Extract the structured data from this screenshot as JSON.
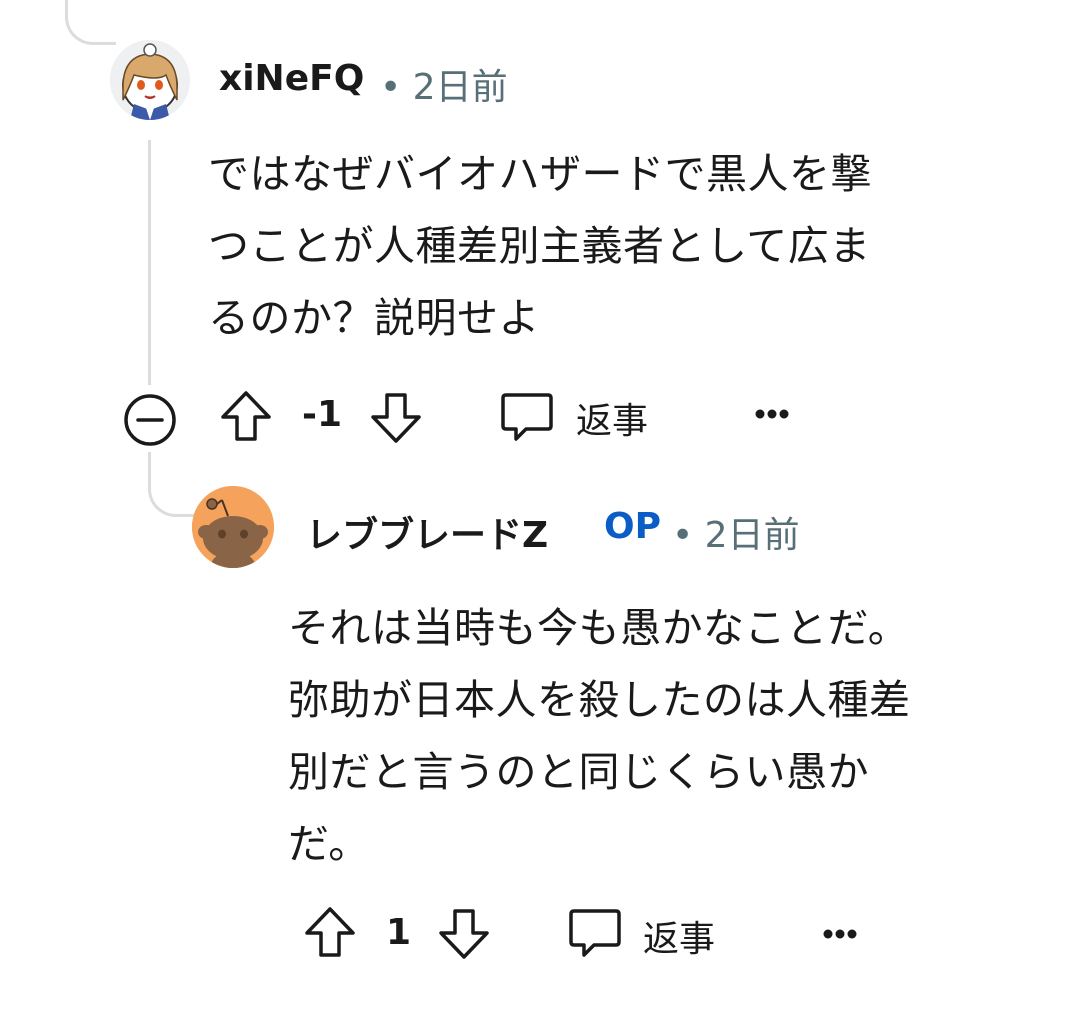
{
  "comments": [
    {
      "author": "xiNeFQ",
      "time": "• 2日前",
      "body": "ではなぜバイオハザードで黒人を撃\nつことが人種差別主義者として広ま\nるのか？説明せよ",
      "score": "-1",
      "reply_label": "返事",
      "more_icon": "more-horizontal-icon",
      "collapse_icon": "collapse-minus-icon"
    },
    {
      "author": "レブブレードZ",
      "badge": "OP",
      "time": "• 2日前",
      "body": "それは当時も今も愚かなことだ。\n弥助が日本人を殺したのは人種差\n別だと言うのと同じくらい愚か\nだ。",
      "score": "1",
      "reply_label": "返事",
      "more_icon": "more-horizontal-icon"
    }
  ],
  "colors": {
    "thread_line": "#dadcdf",
    "meta_text": "#576f76",
    "op_badge": "#0a5cc7",
    "snoo_avatar_bg": "#f5a35c"
  }
}
